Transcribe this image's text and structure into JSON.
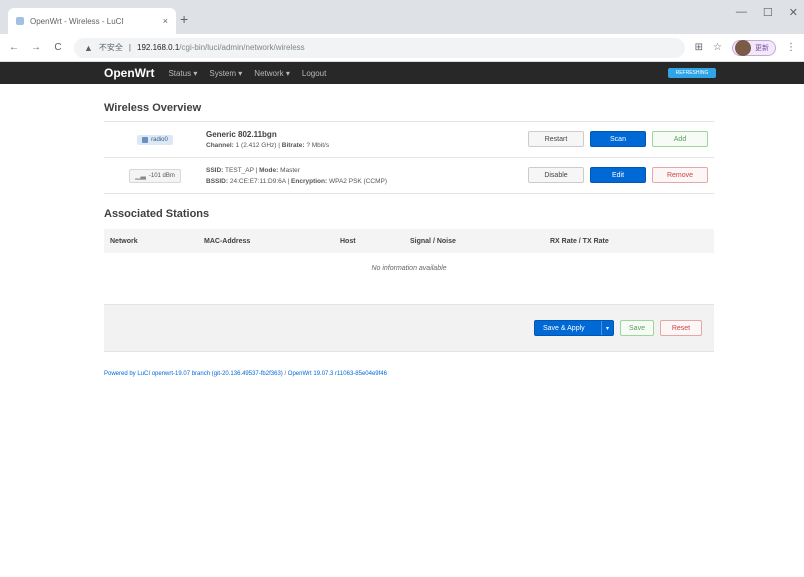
{
  "browser": {
    "tab_title": "OpenWrt - Wireless - LuCI",
    "tab_close": "×",
    "new_tab": "+",
    "win_minimize": "—",
    "win_maximize": "☐",
    "win_close": "✕",
    "nav_back": "←",
    "nav_forward": "→",
    "nav_reload": "C",
    "security_label": "不安全",
    "url_host": "192.168.0.1",
    "url_path": "/cgi-bin/luci/admin/network/wireless",
    "profile_label": "更新"
  },
  "header": {
    "brand": "OpenWrt",
    "menu": [
      "Status ▾",
      "System ▾",
      "Network ▾",
      "Logout"
    ],
    "refresh_badge": "REFRESHING"
  },
  "overview": {
    "title": "Wireless Overview",
    "radio": {
      "chip": "radio0",
      "title": "Generic 802.11bgn",
      "channel_label": "Channel:",
      "channel_value": "1 (2.412 GHz)",
      "bitrate_label": "Bitrate:",
      "bitrate_value": "? Mbit/s",
      "buttons": [
        "Restart",
        "Scan",
        "Add"
      ]
    },
    "network": {
      "chip": "-101 dBm",
      "ssid_label": "SSID:",
      "ssid_value": "TEST_AP",
      "mode_label": "Mode:",
      "mode_value": "Master",
      "bssid_label": "BSSID:",
      "bssid_value": "24:CE:E7:11:D9:6A",
      "encryption_label": "Encryption:",
      "encryption_value": "WPA2 PSK (CCMP)",
      "buttons": [
        "Disable",
        "Edit",
        "Remove"
      ]
    }
  },
  "stations": {
    "title": "Associated Stations",
    "columns": [
      "Network",
      "MAC-Address",
      "Host",
      "Signal / Noise",
      "RX Rate / TX Rate"
    ],
    "empty_text": "No information available"
  },
  "actions": {
    "save_apply": "Save & Apply",
    "dropdown_arrow": "▾",
    "save": "Save",
    "reset": "Reset"
  },
  "footer": {
    "powered_by": "Powered by LuCI openwrt-19.07 branch (git-20.136.49537-fb2f363)",
    "separator": "/",
    "version": "OpenWrt 19.07.3 r11063-85e04e9f46"
  },
  "colors": {
    "primary": "#0069d6",
    "header_bg": "#282828",
    "badge": "#2fa4e7"
  }
}
